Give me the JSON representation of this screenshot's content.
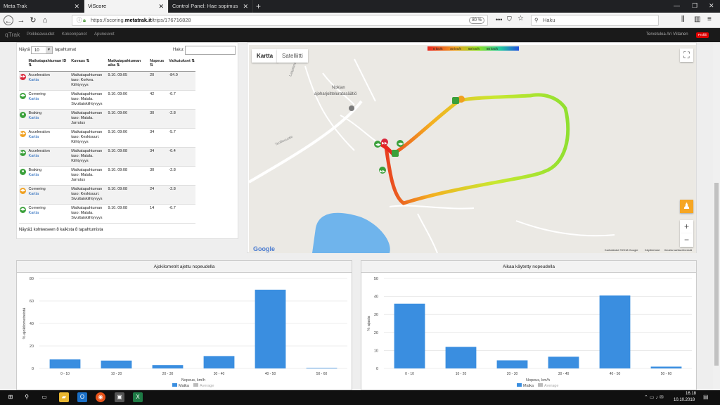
{
  "browser": {
    "tabs": [
      {
        "label": "Meta Trak"
      },
      {
        "label": "ViScore"
      },
      {
        "label": "Control Panel: Hae sopimus"
      }
    ],
    "url_prefix": "https://scoring.",
    "url_domain": "metatrak.it",
    "url_path": "/trips/176716828",
    "zoom": "80 %",
    "search_placeholder": "Haku"
  },
  "app": {
    "logo": "qTrak",
    "nav": [
      "Poikkeavuudet",
      "Kokoonpanot",
      "Apuneuvot"
    ],
    "welcome": "Tervetuloa Ari Viitanen",
    "profile_badge": "Profiili"
  },
  "events_table": {
    "show_label": "Näytä",
    "show_value": "10",
    "show_suffix": "tapahtumat",
    "search_label": "Haku:",
    "columns": [
      "Matkatapahtuman ID",
      "Kuvaus",
      "Matkatapahtuman aika",
      "Nopeus",
      "Vaikutukset"
    ],
    "rows": [
      {
        "type": "Acceleration",
        "link": "Kartta",
        "desc": "Matkatapahtuman taso: Korkea. Kiihtyvyys",
        "time": "9.10. 09:05",
        "speed": "20",
        "effect": "-84.0",
        "color": "#d9263a",
        "glyph": "▶▶"
      },
      {
        "type": "Cornering",
        "link": "Kartta",
        "desc": "Matkatapahtuman taso: Matala. Sivuttaiskiihtyvyys",
        "time": "9.10. 09:06",
        "speed": "42",
        "effect": "-0.7",
        "color": "#3aa03a",
        "glyph": "◀▶"
      },
      {
        "type": "Braking",
        "link": "Kartta",
        "desc": "Matkatapahtuman taso: Matala. Jarrutus",
        "time": "9.10. 09:06",
        "speed": "30",
        "effect": "-2.8",
        "color": "#3aa03a",
        "glyph": "■"
      },
      {
        "type": "Acceleration",
        "link": "Kartta",
        "desc": "Matkatapahtuman taso: Keskisuuri. Kiihtyvyys",
        "time": "9.10. 09:06",
        "speed": "34",
        "effect": "-5.7",
        "color": "#f0a020",
        "glyph": "▶▶"
      },
      {
        "type": "Acceleration",
        "link": "Kartta",
        "desc": "Matkatapahtuman taso: Matala. Kiihtyvyys",
        "time": "9.10. 09:08",
        "speed": "34",
        "effect": "-0.4",
        "color": "#3aa03a",
        "glyph": "▶▶"
      },
      {
        "type": "Braking",
        "link": "Kartta",
        "desc": "Matkatapahtuman taso: Matala. Jarrutus",
        "time": "9.10. 09:08",
        "speed": "30",
        "effect": "-2.8",
        "color": "#3aa03a",
        "glyph": "■"
      },
      {
        "type": "Cornering",
        "link": "Kartta",
        "desc": "Matkatapahtuman taso: Keskisuuri. Sivuttaiskiihtyvyys",
        "time": "9.10. 09:08",
        "speed": "24",
        "effect": "-2.8",
        "color": "#f0a020",
        "glyph": "◀▶"
      },
      {
        "type": "Cornering",
        "link": "Kartta",
        "desc": "Matkatapahtuman taso: Matala. Sivuttaiskiihtyvyys",
        "time": "9.10. 09:08",
        "speed": "14",
        "effect": "-0.7",
        "color": "#3aa03a",
        "glyph": "◀▶"
      }
    ],
    "footer": "Näytä1 kohteeseen 8 kaikista 8 tapahtumista"
  },
  "map": {
    "tab_map": "Kartta",
    "tab_satellite": "Satelliitti",
    "legend": [
      "0 km/h",
      "40 km/h",
      "60 km/h",
      "80 km/h"
    ],
    "place_label": "Nokian ajoharjoitteluratasäätiö",
    "place_label_top": "Nokian",
    "place_label_bottom": "ajoharjoitteluratasäätiö",
    "road_label_1": "Laajalantie",
    "road_label_2": "Teollisuustie",
    "footer_data": "Karttatiedot ©2018 Google",
    "footer_terms": "Käyttöehdot",
    "footer_report": "Ilmoita karttavirheestä",
    "google": "Google"
  },
  "chart_data": [
    {
      "type": "bar",
      "title": "Ajokilometrit ajettu nopeudella",
      "categories": [
        "0 - 10",
        "10 - 20",
        "20 - 30",
        "30 - 40",
        "40 - 50",
        "50 - 60"
      ],
      "series": [
        {
          "name": "Matka",
          "values": [
            8,
            7,
            3,
            11,
            70,
            0.5
          ]
        }
      ],
      "legend": [
        "Matka",
        "Average"
      ],
      "xlabel": "Nopeus, km/h",
      "ylabel": "% ajokilometreistä",
      "ylim": [
        0,
        80
      ],
      "yticks": [
        0,
        20,
        40,
        60,
        80
      ],
      "color": "#3a8ee0"
    },
    {
      "type": "bar",
      "title": "Aikaa käytetty nopeudella",
      "categories": [
        "0 - 10",
        "10 - 20",
        "20 - 30",
        "30 - 40",
        "40 - 50",
        "50 - 60"
      ],
      "series": [
        {
          "name": "Matka",
          "values": [
            36,
            12,
            4.5,
            6.5,
            40.5,
            1
          ]
        }
      ],
      "legend": [
        "Matka",
        "Average"
      ],
      "xlabel": "Nopeus, km/h",
      "ylabel": "% ajasta",
      "ylim": [
        0,
        50
      ],
      "yticks": [
        0,
        10,
        20,
        30,
        40,
        50
      ],
      "color": "#3a8ee0"
    }
  ],
  "taskbar": {
    "time": "16.18",
    "date": "10.10.2018"
  }
}
